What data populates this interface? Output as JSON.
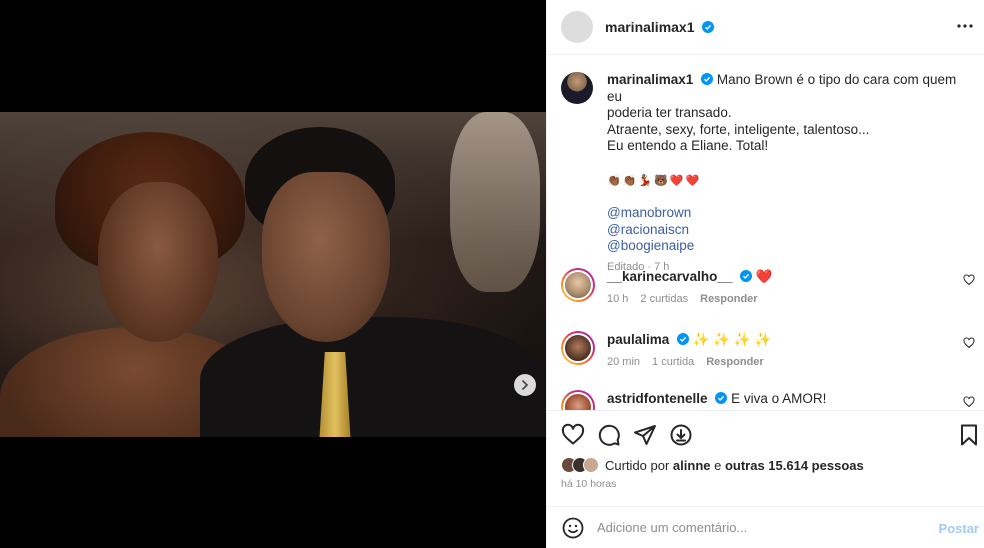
{
  "post": {
    "username": "marinalimax1",
    "verified": true
  },
  "caption": {
    "username": "marinalimax1",
    "lines": [
      "Mano Brown é o tipo do cara com quem eu",
      "poderia ter transado.",
      "Atraente, sexy, forte, inteligente, talentoso...",
      "Eu entendo a Eliane. Total!"
    ],
    "emojis": "👏🏾👏🏾💃🏽🐻❤️❤️",
    "mentions": [
      "@manobrown",
      "@racionaiscn",
      "@boogienaipe"
    ],
    "meta": "Editado · 7 h"
  },
  "comments": [
    {
      "username": "__karinecarvalho__",
      "verified": true,
      "text": "❤️",
      "time": "10 h",
      "likes": "2 curtidas",
      "reply": "Responder"
    },
    {
      "username": "paulalima",
      "verified": true,
      "text": "✨ ✨ ✨ ✨",
      "time": "20 min",
      "likes": "1 curtida",
      "reply": "Responder"
    },
    {
      "username": "astridfontenelle",
      "verified": true,
      "text": "E viva o AMOR!",
      "time": "",
      "likes": "",
      "reply": ""
    }
  ],
  "likes": {
    "prefix": "Curtido por ",
    "user": "alinne",
    "middle": " e ",
    "others": "outras 15.614 pessoas"
  },
  "timestamp": "há 10 horas",
  "add_comment": {
    "placeholder": "Adicione um comentário...",
    "post_label": "Postar"
  },
  "carousel": {
    "slides": 2,
    "active": 1
  },
  "colors": {
    "accent": "#0095f6",
    "verified": "#0095f6",
    "heart": "#ed4956",
    "link": "#3b5fa0"
  }
}
